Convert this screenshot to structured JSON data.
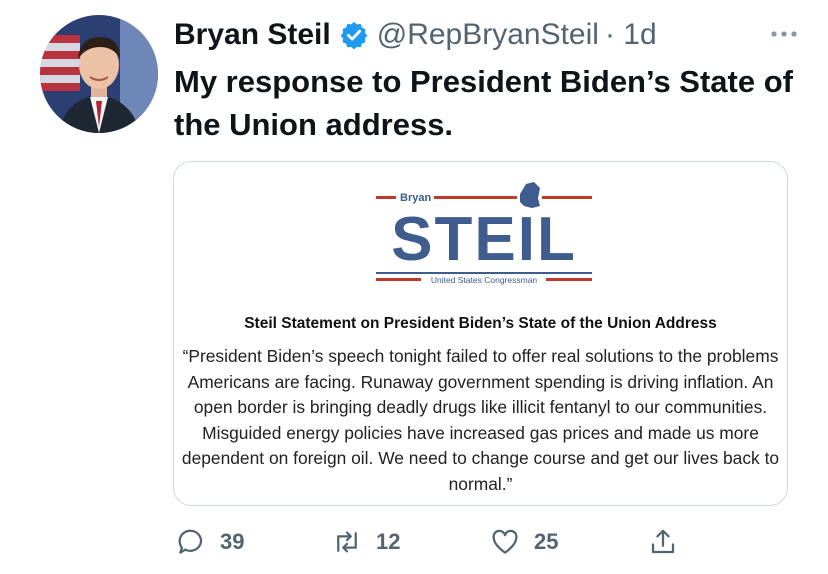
{
  "author": {
    "name": "Bryan Steil",
    "handle": "@RepBryanSteil",
    "time": "· 1d"
  },
  "tweet": {
    "text": "My response to President Biden’s State of the Union address."
  },
  "card": {
    "logo": {
      "top_text": "Bryan",
      "main_text": "STEIL",
      "bottom_text": "United States Congressman"
    },
    "title": "Steil Statement on President Biden’s State of the Union Address",
    "body": "“President Biden’s speech tonight failed to offer real solutions to the problems Americans are facing. Runaway government spending is driving inflation. An open border is bringing deadly drugs like illicit fentanyl to our communities. Misguided energy policies have increased gas prices and made us more dependent on foreign oil. We need to change course and get our lives back to normal.”"
  },
  "actions": {
    "replies": "39",
    "retweets": "12",
    "likes": "25"
  },
  "colors": {
    "verified": "#1d9bf0",
    "logo_blue": "#3e5c8e",
    "logo_red": "#c0392b",
    "muted": "#536471"
  },
  "icons": [
    "verified-badge-icon",
    "more-icon",
    "reply-icon",
    "retweet-icon",
    "like-icon",
    "share-icon"
  ]
}
